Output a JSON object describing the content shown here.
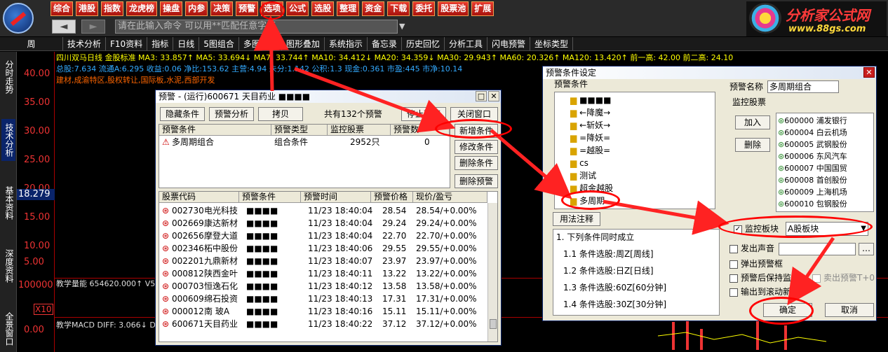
{
  "toolbar": {
    "menu": [
      "综合",
      "港股",
      "指数",
      "龙虎榜",
      "操盘",
      "内参",
      "决策",
      "预警",
      "选项",
      "公式",
      "选股",
      "整理",
      "资金",
      "下载",
      "委托",
      "股票池",
      "扩展"
    ],
    "back": "◄",
    "forward": "►",
    "command_placeholder": "请在此输入命令  可以用**匹配任意字符",
    "brand_title": "分析家公式网",
    "brand_url": "www.88gs.com"
  },
  "tabs": [
    "周",
    "技术分析",
    "F10资料",
    "指标",
    "日线",
    "5图组合",
    "多图组合",
    "图形叠加",
    "系统指示",
    "备忘录",
    "历史回忆",
    "分析工具",
    "闪电预警",
    "坐标类型"
  ],
  "side_tabs": [
    "分时走势",
    "技术分析",
    "基本资料",
    "深度资料",
    "全景窗口"
  ],
  "y_axis": {
    "ticks": [
      "40.00",
      "35.00",
      "30.00",
      "25.00",
      "20.00",
      "15.00",
      "10.00",
      "5.00"
    ],
    "current": "18.279",
    "vol": "100000",
    "x10": "X10",
    "macd_zero": "0.00"
  },
  "info": {
    "row1": "四川双马日线 金股标准 MA3: 33.857↑ MA5: 33.694↓ MA7: 33.744↑ MA10: 34.412↓ MA20: 34.359↓ MA30: 29.943↑ MA60: 20.326↑ MA120: 13.420↑ 前一高: 42.00 前二高: 24.10",
    "row2": "总股:7.634  流通A:6.295  收益:0.06  净比:153.62  主营:4.94  未分:1.142  公积:1.3  现金:0.361  市盈:445  市净:10.14",
    "row3": "建材,成渝特区,股权转让,国际板,水泥,西部开发",
    "vol_label": "教学量能 654620.000↑ V5",
    "macd_label": "教学MACD DIFF: 3.066↓ DEA:"
  },
  "alert_dialog": {
    "title": "预警 - (运行)600671 天目药业 ■■■■",
    "buttons": [
      "隐藏条件",
      "预警分析",
      "拷贝",
      "停止预警",
      "关闭窗口"
    ],
    "count_text": "共有132个预警",
    "side_buttons": [
      "新增条件",
      "修改条件",
      "删除条件",
      "删除预警"
    ],
    "cond_headers": [
      "预警条件",
      "预警类型",
      "监控股票",
      "预警数"
    ],
    "cond_row": {
      "name": "多周期组合",
      "type": "组合条件",
      "stocks": "2952只",
      "count": "0"
    },
    "stock_headers": [
      "股票代码",
      "预警条件",
      "预警时间",
      "预警价格",
      "现价/盈亏"
    ],
    "stocks": [
      {
        "code": "002730",
        "name": "电光科技",
        "cond": "■■■■",
        "time": "11/23 18:40:04",
        "price": "28.54",
        "now": "28.54/+0.00%"
      },
      {
        "code": "002669",
        "name": "康达新材",
        "cond": "■■■■",
        "time": "11/23 18:40:04",
        "price": "29.24",
        "now": "29.24/+0.00%"
      },
      {
        "code": "002656",
        "name": "摩登大道",
        "cond": "■■■■",
        "time": "11/23 18:40:04",
        "price": "22.70",
        "now": "22.70/+0.00%"
      },
      {
        "code": "002346",
        "name": "柘中股份",
        "cond": "■■■■",
        "time": "11/23 18:40:06",
        "price": "29.55",
        "now": "29.55/+0.00%"
      },
      {
        "code": "002201",
        "name": "九鼎新材",
        "cond": "■■■■",
        "time": "11/23 18:40:07",
        "price": "23.97",
        "now": "23.97/+0.00%"
      },
      {
        "code": "000812",
        "name": "陕西金叶",
        "cond": "■■■■",
        "time": "11/23 18:40:11",
        "price": "13.22",
        "now": "13.22/+0.00%"
      },
      {
        "code": "000703",
        "name": "恒逸石化",
        "cond": "■■■■",
        "time": "11/23 18:40:12",
        "price": "13.58",
        "now": "13.58/+0.00%"
      },
      {
        "code": "000609",
        "name": "绵石投资",
        "cond": "■■■■",
        "time": "11/23 18:40:13",
        "price": "17.31",
        "now": "17.31/+0.00%"
      },
      {
        "code": "000012",
        "name": "南 玻A",
        "cond": "■■■■",
        "time": "11/23 18:40:16",
        "price": "15.11",
        "now": "15.11/+0.00%"
      },
      {
        "code": "600671",
        "name": "天目药业",
        "cond": "■■■■",
        "time": "11/23 18:40:22",
        "price": "37.12",
        "now": "37.12/+0.00%"
      }
    ]
  },
  "settings_dialog": {
    "title": "预警条件设定",
    "group_conditions": "预警条件",
    "tree": [
      "■■■■",
      "←降魔→",
      "←斩妖→",
      "=降妖=",
      "=越股=",
      "cs",
      "测试",
      "超金越股",
      "多周期"
    ],
    "usage_button": "用法注释",
    "name_label": "预警名称",
    "name_value": "多周期组合",
    "group_stocks": "监控股票",
    "add": "加入",
    "delete": "删除",
    "stocks": [
      "600000 浦发银行",
      "600004 白云机场",
      "600005 武钢股份",
      "600006 东风汽车",
      "600007 中国国贸",
      "600008 首创股份",
      "600009 上海机场",
      "600010 包钢股份"
    ],
    "monitor_block_label": "监控板块",
    "monitor_block_value": "A股板块",
    "sound_label": "发出声音",
    "popup_label": "弹出预警框",
    "keep_label": "预警后保持监控",
    "sell_label": "卖出预警T+0",
    "output_label": "输出到滚动新闻",
    "conds": [
      "1. 下列条件同时成立",
      "1.1 条件选股:周Z[周线]",
      "1.2 条件选股:日Z[日线]",
      "1.3 条件选股:60Z[60分钟]",
      "1.4 条件选股:30Z[30分钟]"
    ],
    "ok": "确定",
    "cancel": "取消"
  }
}
